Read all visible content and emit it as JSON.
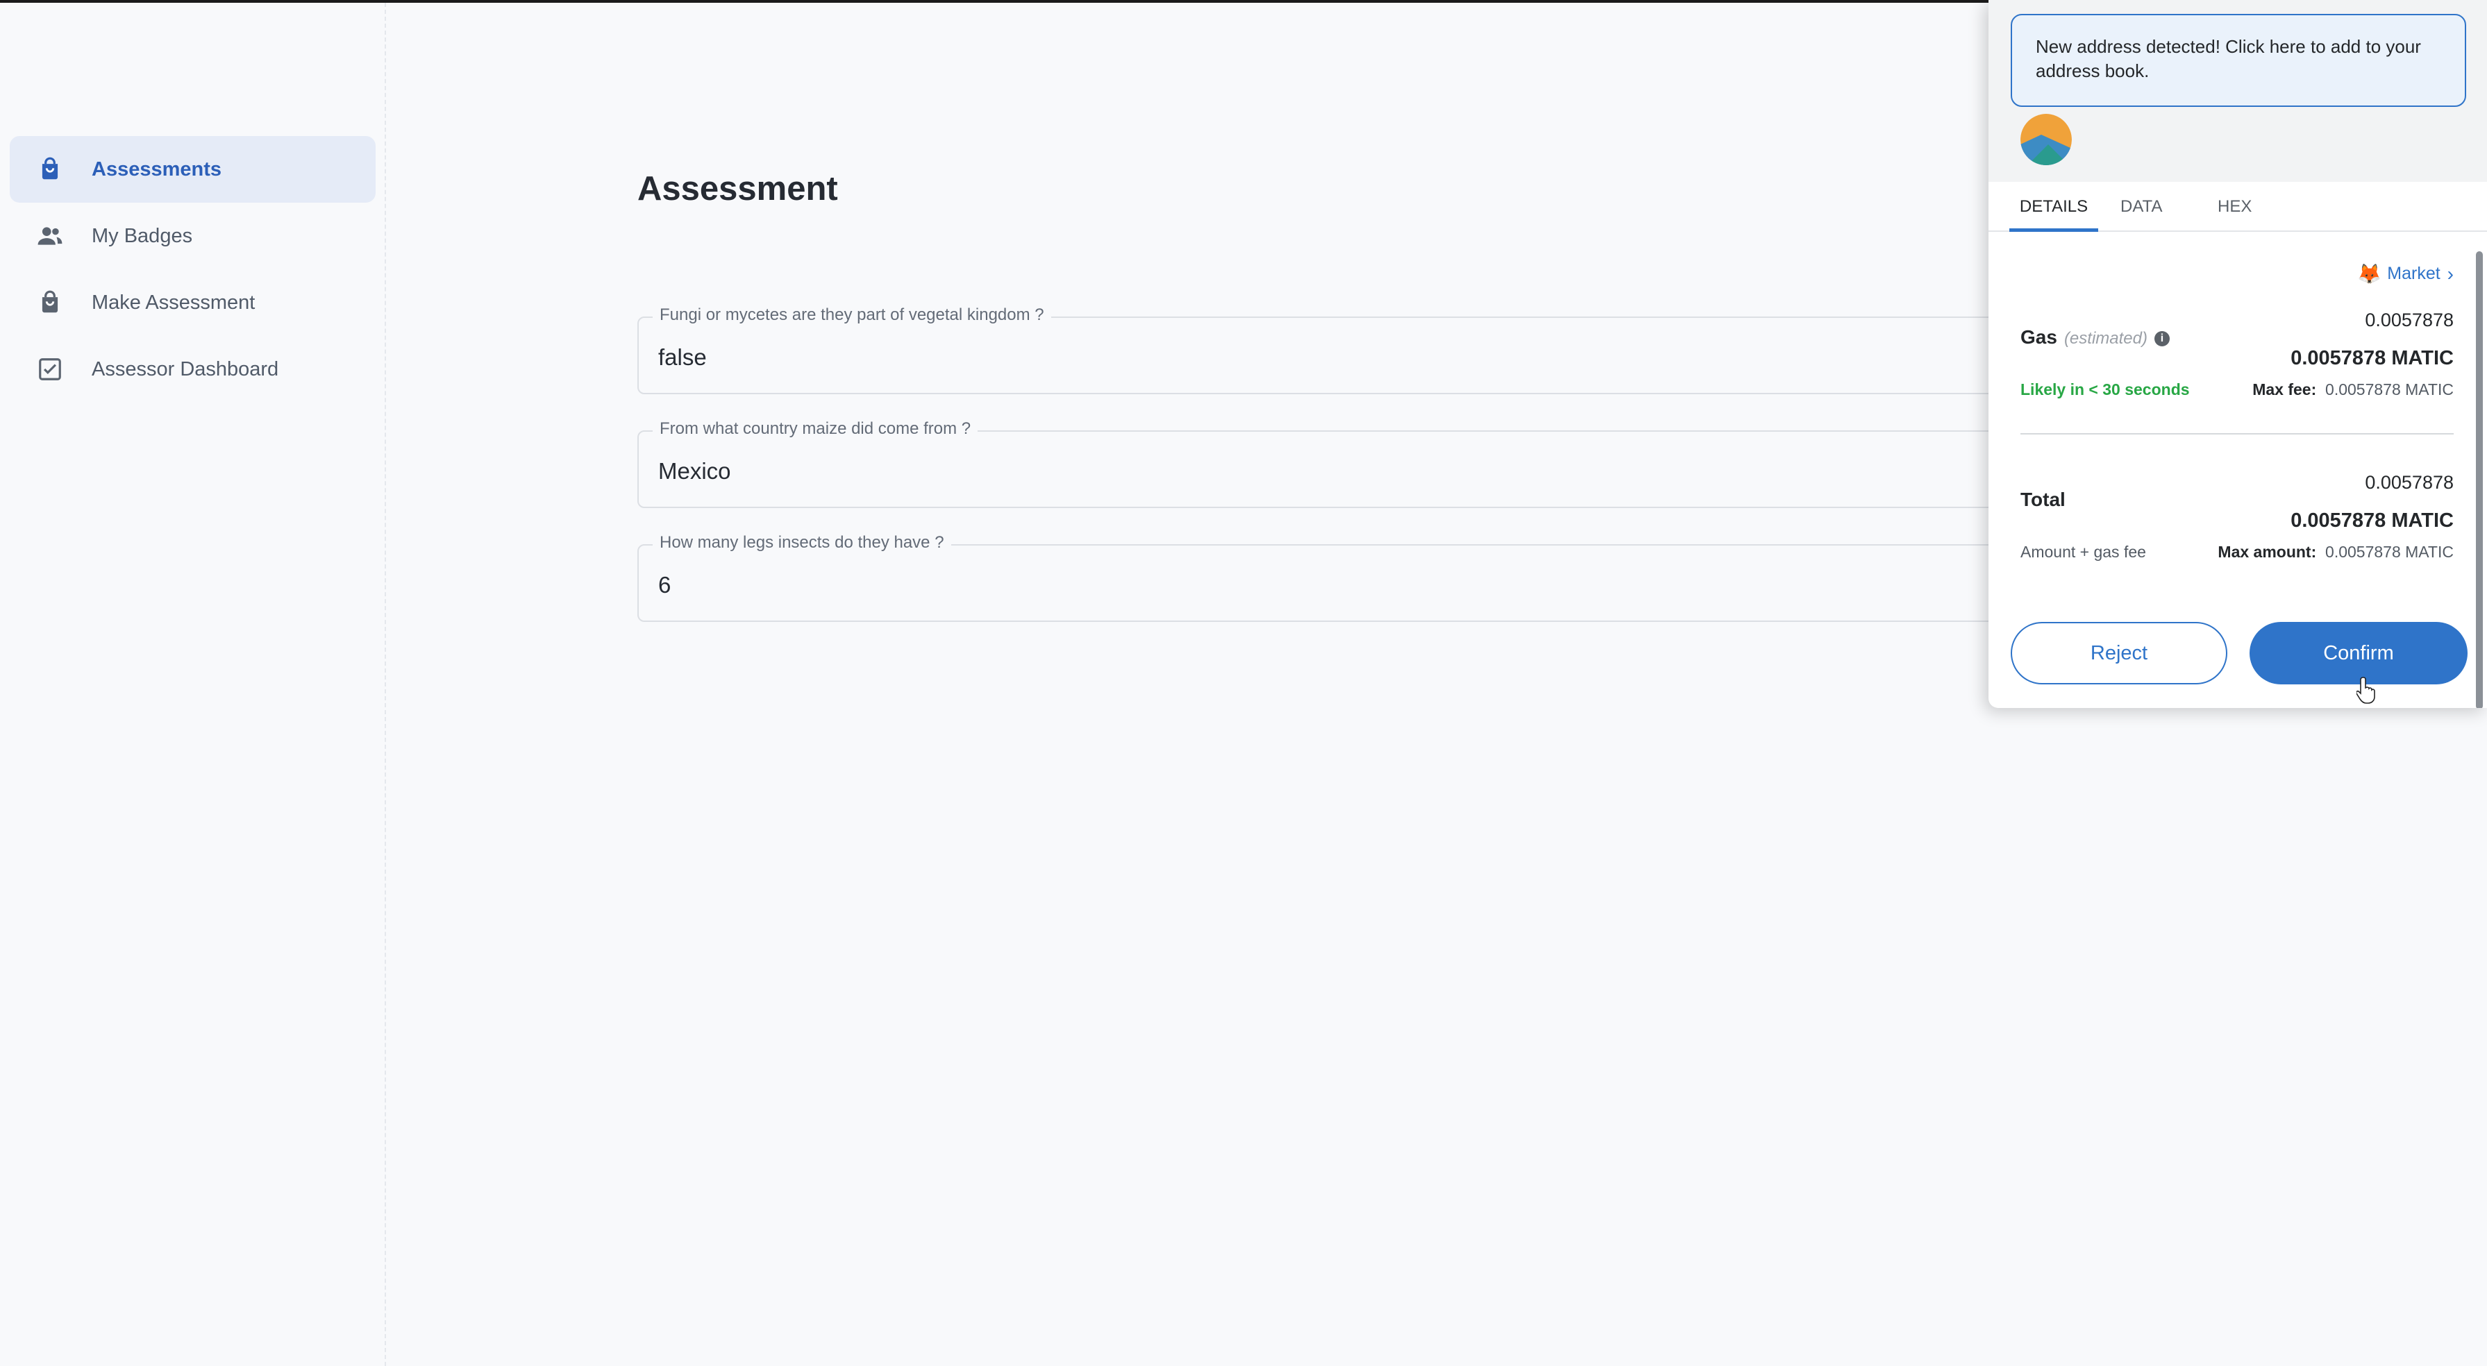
{
  "sidebar": {
    "items": [
      {
        "label": "Assessments",
        "icon": "bag-icon",
        "active": true
      },
      {
        "label": "My Badges",
        "icon": "people-icon",
        "active": false
      },
      {
        "label": "Make Assessment",
        "icon": "bag-icon",
        "active": false
      },
      {
        "label": "Assessor Dashboard",
        "icon": "checkbox-icon",
        "active": false
      }
    ]
  },
  "main": {
    "title": "Assessment",
    "fields": [
      {
        "label": "Fungi or mycetes are they part of vegetal kingdom ?",
        "value": "false"
      },
      {
        "label": "From what country maize did come from ?",
        "value": "Mexico"
      },
      {
        "label": "How many legs insects do they have ?",
        "value": "6"
      }
    ]
  },
  "popup": {
    "notice": "New address detected! Click here to add to your address book.",
    "tabs": [
      "DETAILS",
      "DATA",
      "HEX"
    ],
    "active_tab": "DETAILS",
    "market_label": "Market",
    "gas": {
      "label": "Gas",
      "estimated": "(estimated)",
      "amount": "0.0057878",
      "amount_matic": "0.0057878 MATIC",
      "likely": "Likely in < 30 seconds",
      "max_fee_label": "Max fee:",
      "max_fee": "0.0057878 MATIC"
    },
    "total": {
      "label": "Total",
      "amount": "0.0057878",
      "amount_matic": "0.0057878 MATIC",
      "sub_label": "Amount + gas fee",
      "max_amount_label": "Max amount:",
      "max_amount": "0.0057878 MATIC"
    },
    "reject_label": "Reject",
    "confirm_label": "Confirm"
  },
  "colors": {
    "accent": "#2f74c9",
    "sidebar_active_bg": "#e5ebf7",
    "sidebar_active_text": "#2c5fb8",
    "success": "#28a745"
  }
}
